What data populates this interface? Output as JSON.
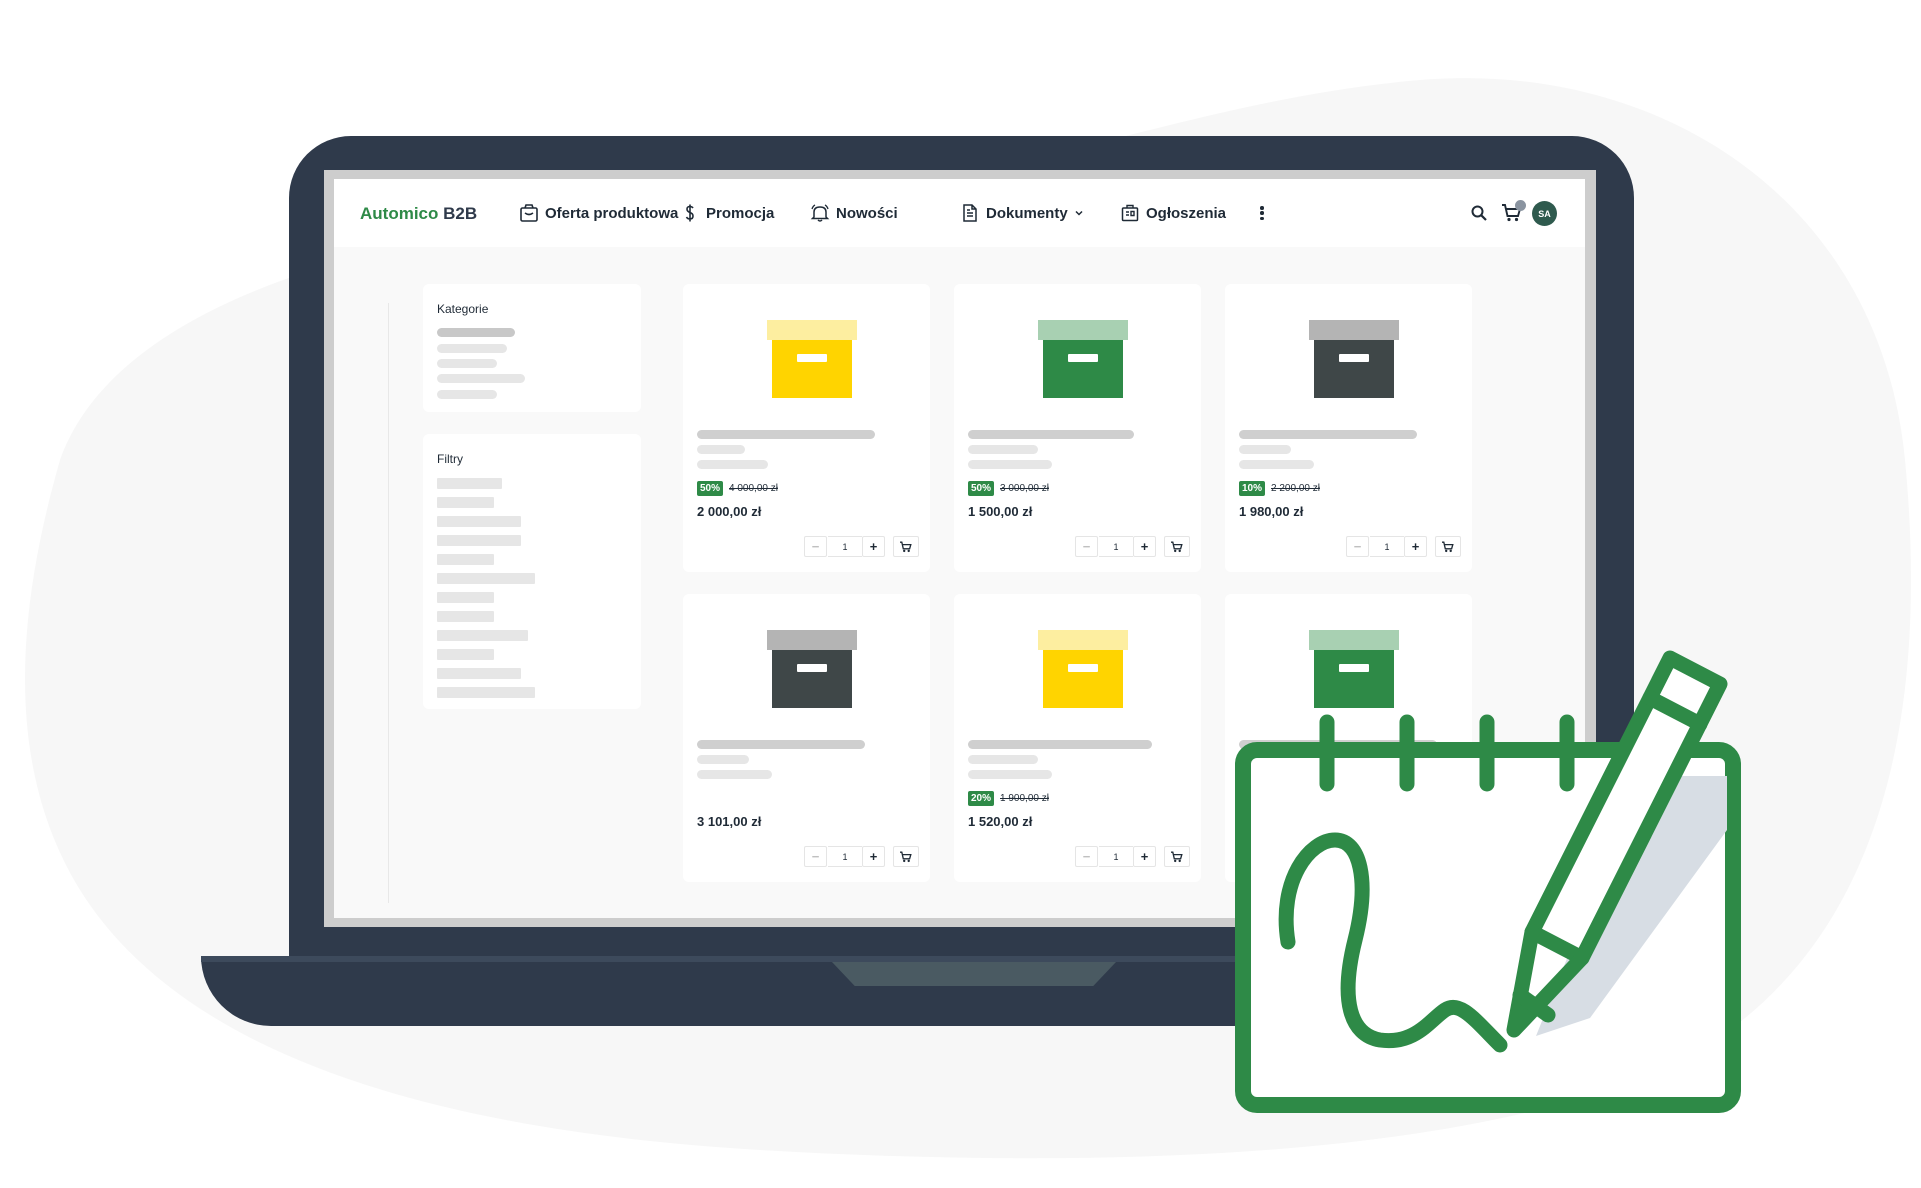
{
  "header": {
    "logo_primary": "Automico",
    "logo_secondary": "B2B",
    "nav": [
      {
        "label": "Oferta produktowa",
        "icon": "bag-icon"
      },
      {
        "label": "Promocja",
        "icon": "dollar-icon"
      },
      {
        "label": "Nowości",
        "icon": "bell-icon"
      },
      {
        "label": "Dokumenty",
        "icon": "document-icon"
      },
      {
        "label": "Ogłoszenia",
        "icon": "notice-icon"
      }
    ],
    "avatar_initials": "SA"
  },
  "sidebar": {
    "categories_title": "Kategorie",
    "filters_title": "Filtry"
  },
  "products": [
    {
      "box_color": "#ffd400",
      "lid_color": "#fdeea0",
      "discount": "50%",
      "old_price": "4 000,00 zł",
      "price": "2 000,00 zł",
      "qty": "1"
    },
    {
      "box_color": "#2e8a47",
      "lid_color": "#a8d0b2",
      "discount": "50%",
      "old_price": "3 000,00 zł",
      "price": "1 500,00 zł",
      "qty": "1"
    },
    {
      "box_color": "#3f4748",
      "lid_color": "#b4b4b4",
      "discount": "10%",
      "old_price": "2 200,00 zł",
      "price": "1 980,00 zł",
      "qty": "1"
    },
    {
      "box_color": "#3f4748",
      "lid_color": "#b4b4b4",
      "discount": "",
      "old_price": "",
      "price": "3 101,00 zł",
      "qty": "1"
    },
    {
      "box_color": "#ffd400",
      "lid_color": "#fdeea0",
      "discount": "20%",
      "old_price": "1 900,00 zł",
      "price": "1 520,00 zł",
      "qty": "1"
    },
    {
      "box_color": "#2e8a47",
      "lid_color": "#a8d0b2",
      "discount": "",
      "old_price": "",
      "price": "",
      "qty": ""
    }
  ],
  "colors": {
    "brand_green": "#2e8a47",
    "laptop_body": "#2f3a4b",
    "signature_stroke": "#2e8a47"
  }
}
